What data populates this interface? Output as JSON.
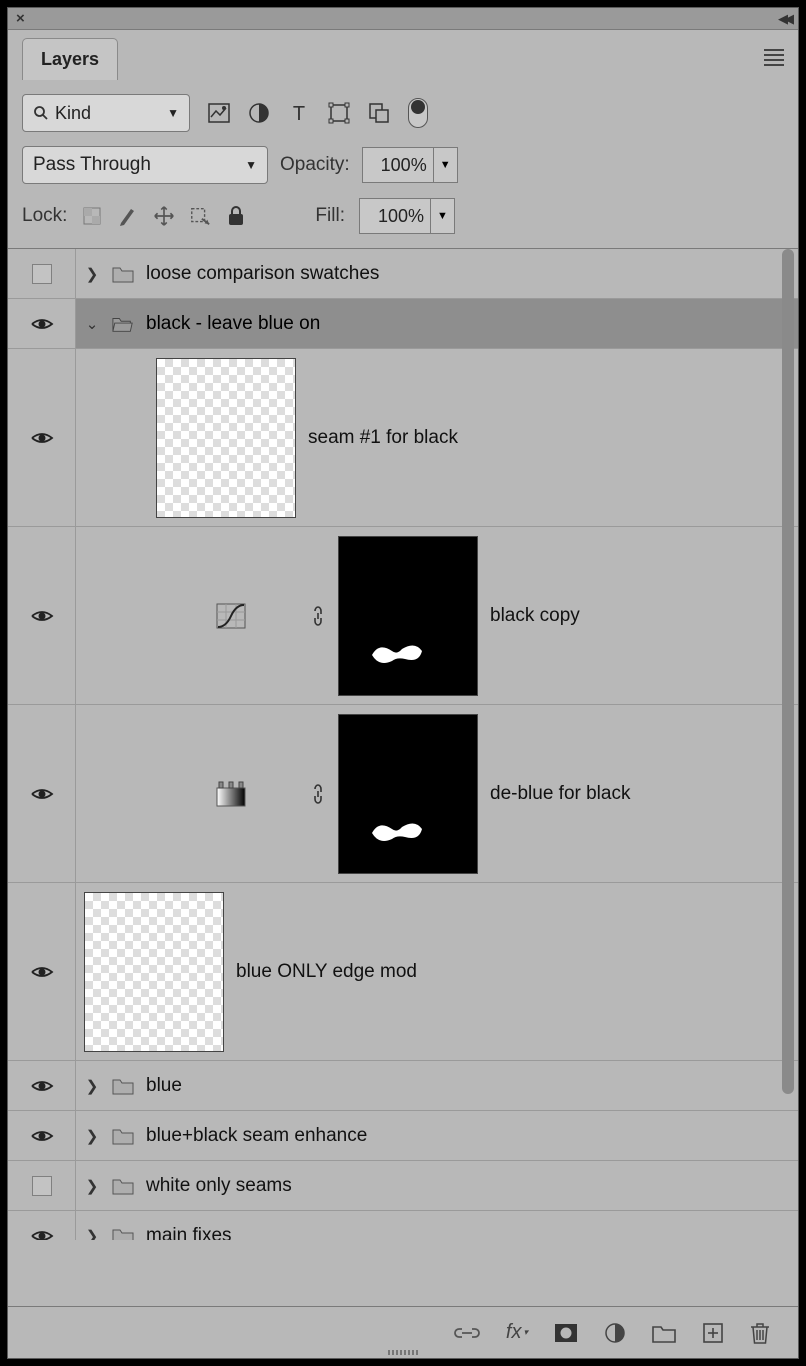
{
  "panel": {
    "tab_label": "Layers",
    "filter_label": "Kind",
    "blend_mode": "Pass Through",
    "opacity_label": "Opacity:",
    "opacity_value": "100%",
    "lock_label": "Lock:",
    "fill_label": "Fill:",
    "fill_value": "100%"
  },
  "layers": [
    {
      "name": "loose comparison swatches",
      "visible": false,
      "type": "group",
      "expanded": false,
      "selected": false,
      "depth": 0
    },
    {
      "name": "black - leave blue on",
      "visible": true,
      "type": "group",
      "expanded": true,
      "selected": true,
      "depth": 0
    },
    {
      "name": "seam #1 for black",
      "visible": true,
      "type": "pixel",
      "thumb": "trans",
      "depth": 1
    },
    {
      "name": "black copy",
      "visible": true,
      "type": "adjust",
      "adjust_kind": "curves",
      "mask": "black-bow",
      "depth": 2
    },
    {
      "name": "de-blue for black",
      "visible": true,
      "type": "adjust",
      "adjust_kind": "gradient-map",
      "mask": "black-bow",
      "depth": 2
    },
    {
      "name": "blue ONLY edge mod",
      "visible": true,
      "type": "pixel",
      "thumb": "trans",
      "depth": 0,
      "no_indent_inside": true
    },
    {
      "name": "blue",
      "visible": true,
      "type": "group",
      "expanded": false,
      "depth": 0
    },
    {
      "name": "blue+black seam enhance",
      "visible": true,
      "type": "group",
      "expanded": false,
      "depth": 0
    },
    {
      "name": "white only seams",
      "visible": false,
      "type": "group",
      "expanded": false,
      "depth": 0
    },
    {
      "name": "main fixes",
      "visible": true,
      "type": "group",
      "expanded": false,
      "depth": 0
    }
  ],
  "footer_icons": [
    "link",
    "fx",
    "mask",
    "adjustment",
    "group",
    "new",
    "trash"
  ]
}
